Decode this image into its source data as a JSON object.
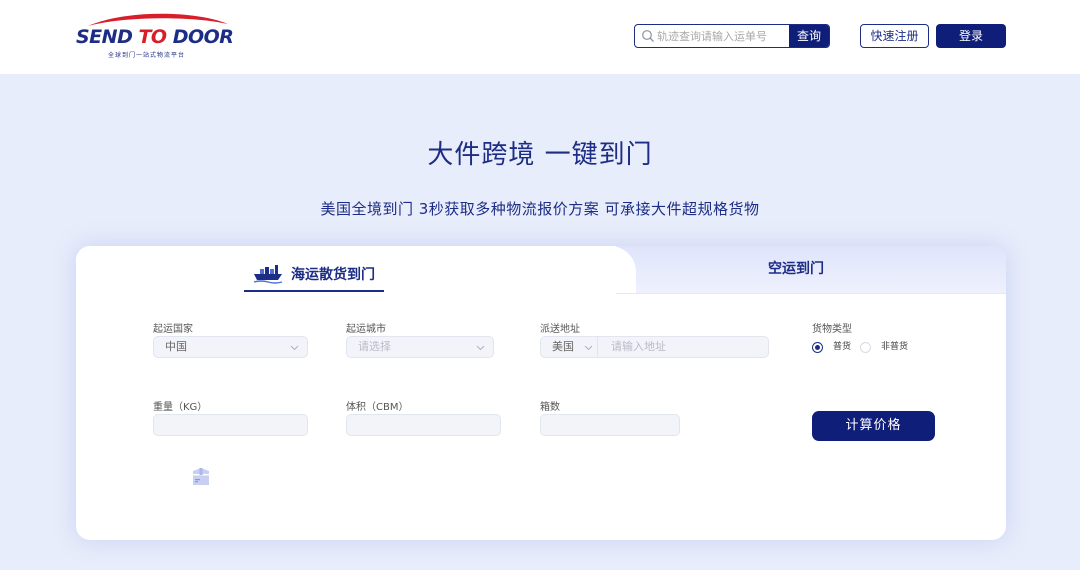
{
  "header": {
    "logo_text": "SEND TO DOOR",
    "logo_send": "SEND",
    "logo_to": " TO ",
    "logo_door": "DOOR",
    "logo_slogan": "全球到门一站式物流平台",
    "search_placeholder": "轨迹查询请输入运单号",
    "search_button": "查询",
    "register_button": "快速注册",
    "login_button": "登录"
  },
  "hero": {
    "title": "大件跨境 一键到门",
    "subtitle": "美国全境到门 3秒获取多种物流报价方案 可承接大件超规格货物"
  },
  "tabs": {
    "sea": "海运散货到门",
    "air": "空运到门",
    "sea_icon": "cargo-ship-icon"
  },
  "form": {
    "origin_country_label": "起运国家",
    "origin_country_value": "中国",
    "origin_city_label": "起运城市",
    "origin_city_placeholder": "请选择",
    "delivery_address_label": "派送地址",
    "delivery_country_value": "美国",
    "delivery_address_placeholder": "请输入地址",
    "cargo_type_label": "货物类型",
    "cargo_type_options": [
      "普货",
      "非普货"
    ],
    "cargo_type_selected": "普货",
    "weight_label": "重量（KG）",
    "volume_label": "体积（CBM）",
    "boxes_label": "箱数",
    "calculate_button": "计算价格",
    "box_icon": "package-box-icon"
  },
  "colors": {
    "primary": "#0f1e78",
    "accent_red": "#d81e2a",
    "page_bg": "#e8edfb"
  }
}
